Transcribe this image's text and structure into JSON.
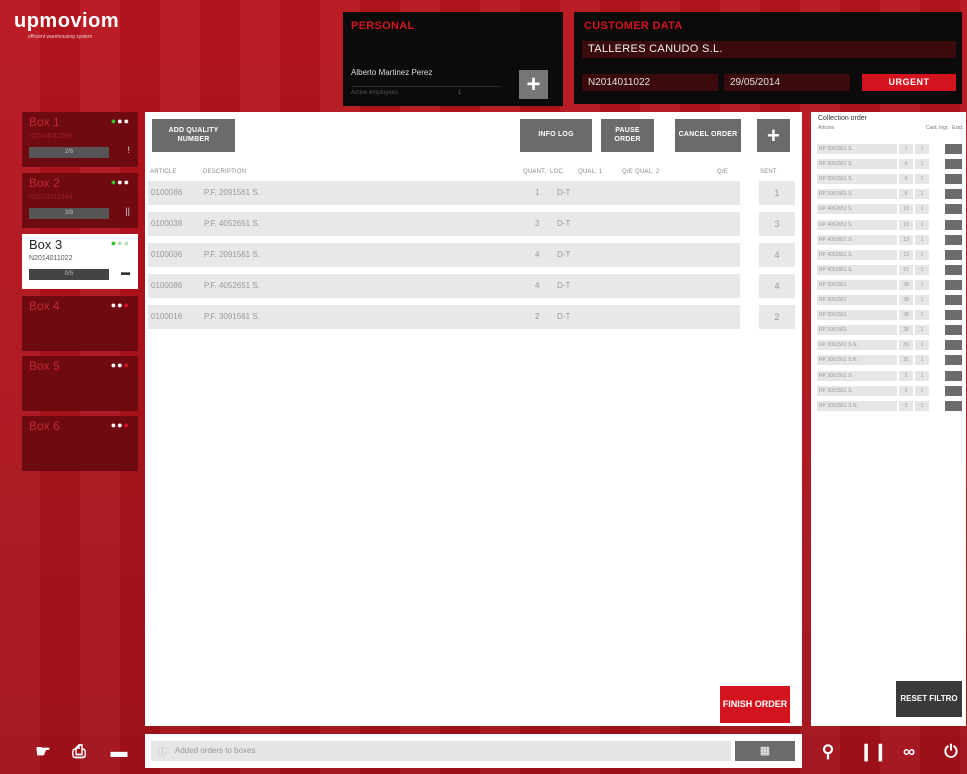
{
  "header": {
    "logo_word": "upmoviom",
    "logo_tag": "efficient warehousing system",
    "personal": {
      "title": "PERSONAL",
      "name": "Alberto Martinez Perez",
      "sub_label": "Active employees",
      "sub_count": "1"
    },
    "customer": {
      "title": "CUSTOMER DATA",
      "company": "TALLERES CANUDO S.L.",
      "order_no": "N2014011022",
      "order_date": "29/05/2014",
      "urgent": "URGENT"
    }
  },
  "boxes": [
    {
      "name": "Box 1",
      "number": "N2014011006",
      "bar": "2/6",
      "icon": "!",
      "dots": [
        "g",
        "w",
        "w"
      ],
      "active": false
    },
    {
      "name": "Box 2",
      "number": "N2014011048",
      "bar": "3/8",
      "icon": "||",
      "dots": [
        "g",
        "w",
        "w"
      ],
      "active": false
    },
    {
      "name": "Box 3",
      "number": "N2014011022",
      "bar": "0/5",
      "icon": "▬",
      "dots": [
        "g",
        "lg",
        "lg"
      ],
      "active": true
    },
    {
      "name": "Box 4",
      "number": "",
      "bar": "",
      "icon": "",
      "dots": [
        "w",
        "w",
        "r"
      ],
      "active": false
    },
    {
      "name": "Box 5",
      "number": "",
      "bar": "",
      "icon": "",
      "dots": [
        "w",
        "w",
        "r"
      ],
      "active": false
    },
    {
      "name": "Box 6",
      "number": "",
      "bar": "",
      "icon": "",
      "dots": [
        "w",
        "w",
        "r"
      ],
      "active": false
    }
  ],
  "toolbar": {
    "add_quality": "ADD QUALITY NUMBER",
    "info_log": "INFO LOG",
    "pause_order": "PAUSE ORDER",
    "cancel_order": "CANCEL ORDER",
    "plus": "+"
  },
  "table": {
    "headers": [
      "ARTICLE",
      "DESCRIPTION",
      "QUANT.",
      "LOC.",
      "QUAL. 1",
      "Q/E",
      "QUAL. 2",
      "Q/E",
      "SENT"
    ],
    "rows": [
      {
        "article": "0100086",
        "description": "P.F. 2091561 S.",
        "qty": "1",
        "loc": "D-T",
        "sent": "1"
      },
      {
        "article": "0100038",
        "description": "P.F. 4052651 S.",
        "qty": "3",
        "loc": "D-T",
        "sent": "3"
      },
      {
        "article": "0100036",
        "description": "P.F. 2091561 S.",
        "qty": "4",
        "loc": "D-T",
        "sent": "4"
      },
      {
        "article": "0100086",
        "description": "P.F. 4052651 S.",
        "qty": "4",
        "loc": "D-T",
        "sent": "4"
      },
      {
        "article": "0100016",
        "description": "P.F. 3091561 S.",
        "qty": "2",
        "loc": "D-T",
        "sent": "2"
      }
    ],
    "finish": "FINISH ORDER"
  },
  "collection": {
    "title": "Collection order",
    "headers": [
      "Articles",
      "Cant.",
      "Ingr.",
      "Estd."
    ],
    "rows": [
      {
        "a": "RP 3091561 S.",
        "b": "1",
        "c": "1"
      },
      {
        "a": "RP 3091561 S.",
        "b": "6",
        "c": "1"
      },
      {
        "a": "RP 3091561 S.",
        "b": "8",
        "c": "1"
      },
      {
        "a": "RP 3091561 S.",
        "b": "8",
        "c": "1"
      },
      {
        "a": "RP 4052651 S.",
        "b": "13",
        "c": "1"
      },
      {
        "a": "RP 4052651 S.",
        "b": "13",
        "c": "1"
      },
      {
        "a": "RP 4052651 S.",
        "b": "13",
        "c": "1"
      },
      {
        "a": "RP 4052651 S.",
        "b": "13",
        "c": "1"
      },
      {
        "a": "RP 4052651 S.",
        "b": "21",
        "c": "1"
      },
      {
        "a": "RP 3091561",
        "b": "28",
        "c": "1"
      },
      {
        "a": "RP 3091561",
        "b": "28",
        "c": "1"
      },
      {
        "a": "RP 3091561",
        "b": "28",
        "c": "1"
      },
      {
        "a": "RP 3091561",
        "b": "28",
        "c": "1"
      },
      {
        "a": "RP 3091561 S.N.",
        "b": "30",
        "c": "1"
      },
      {
        "a": "RP 3091561 S.N.",
        "b": "31",
        "c": "1"
      },
      {
        "a": "RP 3091561 S.",
        "b": "3",
        "c": "1"
      },
      {
        "a": "RP 3091561 S.",
        "b": "3",
        "c": "1"
      },
      {
        "a": "RP 3091561 S.N.",
        "b": "3",
        "c": "1"
      }
    ],
    "reset": "RESET FILTRO"
  },
  "status": {
    "text": "Added orders to boxes",
    "icon": "info-icon",
    "cal_icon": "calendar-icon"
  },
  "bottom_icons": {
    "left": [
      "hand-pointer-icon",
      "printer-icon",
      "chat-icon"
    ],
    "right": [
      "search-icon",
      "pause-icon",
      "link-icon",
      "power-icon"
    ]
  }
}
